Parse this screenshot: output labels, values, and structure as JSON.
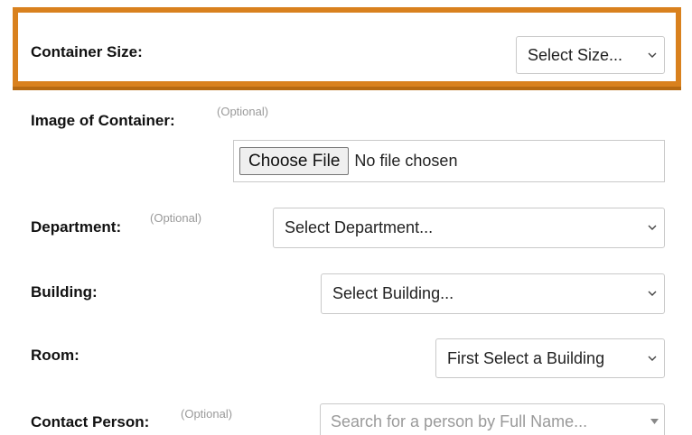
{
  "form": {
    "container_size": {
      "label": "Container Size:",
      "value": "Select Size..."
    },
    "image": {
      "label": "Image of Container:",
      "optional": "(Optional)",
      "button_label": "Choose File",
      "status": "No file chosen"
    },
    "department": {
      "label": "Department:",
      "optional": "(Optional)",
      "value": "Select Department..."
    },
    "building": {
      "label": "Building:",
      "value": "Select Building..."
    },
    "room": {
      "label": "Room:",
      "value": "First Select a Building"
    },
    "contact": {
      "label": "Contact Person:",
      "optional": "(Optional)",
      "placeholder": "Search for a person by Full Name..."
    }
  },
  "colors": {
    "highlight_border": "#d9811e",
    "optional_text": "#9a9a9a"
  },
  "icons": {
    "select_arrow": "chevron-down-icon",
    "search_arrow": "caret-down-icon"
  }
}
